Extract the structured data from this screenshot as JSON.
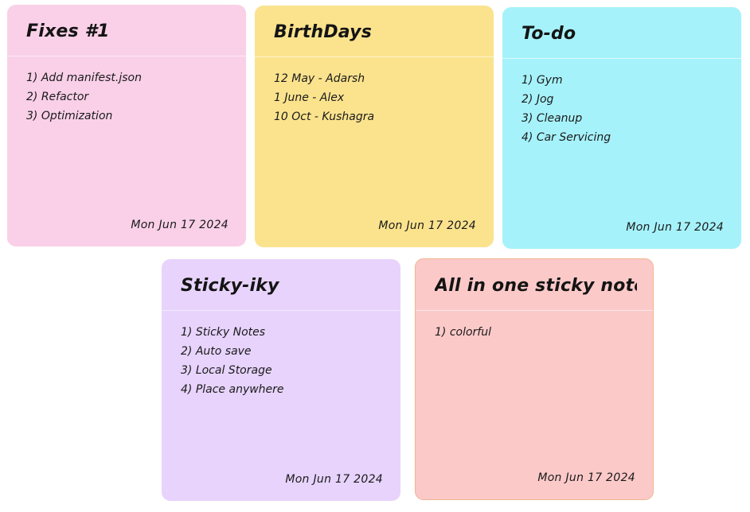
{
  "notes": [
    {
      "title": "Fixes #1",
      "lines": [
        "1) Add manifest.json",
        "2) Refactor",
        "3) Optimization"
      ],
      "date": "Mon Jun 17 2024",
      "color": "#f9d0e8"
    },
    {
      "title": "BirthDays",
      "lines": [
        "12 May - Adarsh",
        "1 June - Alex",
        "10 Oct - Kushagra"
      ],
      "date": "Mon Jun 17 2024",
      "color": "#fbe38e"
    },
    {
      "title": "To-do",
      "lines": [
        "1) Gym",
        "2) Jog",
        "3) Cleanup",
        "4) Car Servicing"
      ],
      "date": "Mon Jun 17 2024",
      "color": "#a6f2fb"
    },
    {
      "title": "Sticky-iky",
      "lines": [
        "1) Sticky Notes",
        "2) Auto save",
        "3) Local Storage",
        "4) Place anywhere"
      ],
      "date": "Mon Jun 17 2024",
      "color": "#e7d3fc"
    },
    {
      "title": "All in one sticky notes",
      "lines": [
        "1) colorful"
      ],
      "date": "Mon Jun 17 2024",
      "color": "#fcc9c9"
    }
  ]
}
